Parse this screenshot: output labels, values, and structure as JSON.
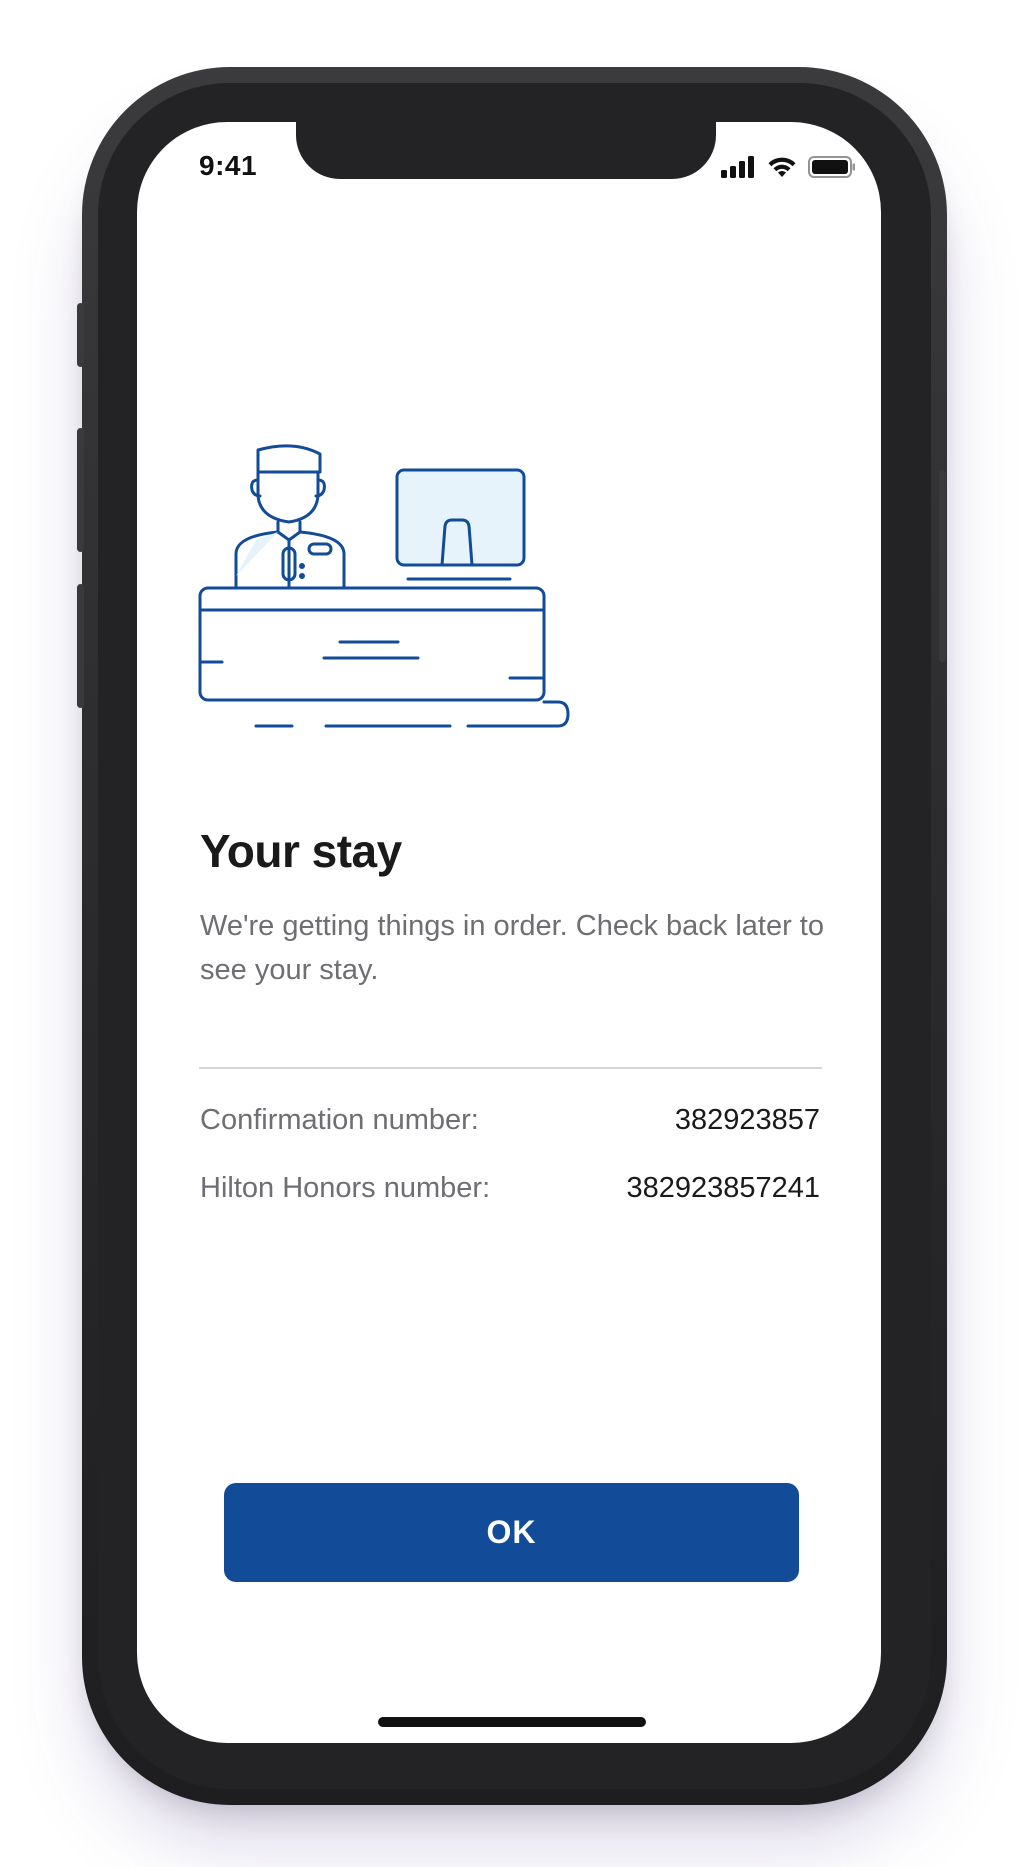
{
  "status_bar": {
    "time": "9:41",
    "signal_icon": "signal-bars-icon",
    "wifi_icon": "wifi-icon",
    "battery_icon": "battery-icon"
  },
  "illustration": {
    "icon": "front-desk-receptionist-illustration",
    "accent_color": "#124c98",
    "fill_color": "#e6f3fb"
  },
  "content": {
    "title": "Your stay",
    "subtitle": "We're getting things in order. Check back later to see your stay.",
    "rows": [
      {
        "label": "Confirmation number:",
        "value": "382923857"
      },
      {
        "label": "Hilton Honors number:",
        "value": "382923857241"
      }
    ]
  },
  "actions": {
    "ok_label": "OK",
    "button_color": "#124c98"
  }
}
